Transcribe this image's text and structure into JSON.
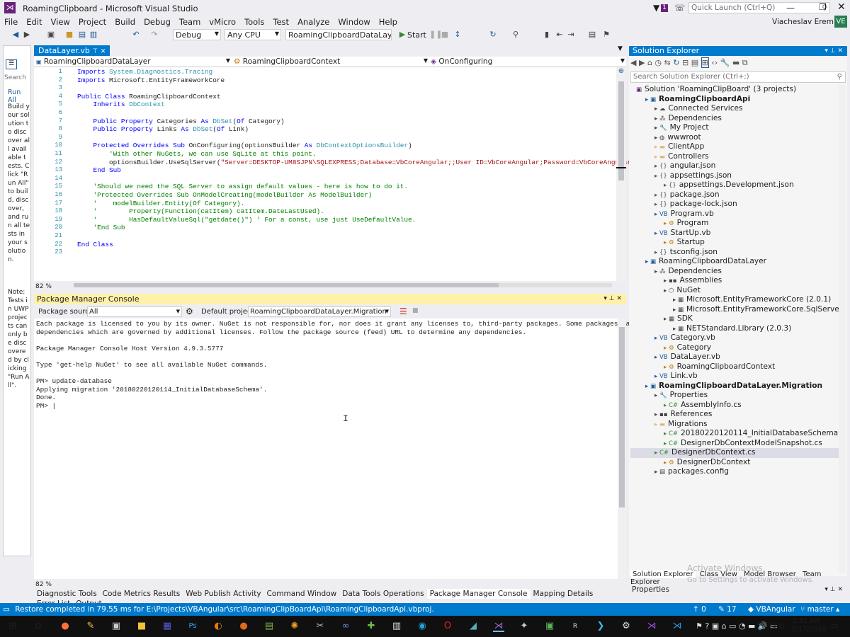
{
  "title": {
    "app": "RoamingClipboard - Microsoft Visual Studio",
    "quick_launch": "Quick Launch (Ctrl+Q)",
    "user": "Viacheslav Eremin",
    "avatar": "VE",
    "notif_count": "1"
  },
  "menu": [
    "File",
    "Edit",
    "View",
    "Project",
    "Build",
    "Debug",
    "Team",
    "vMicro",
    "Tools",
    "Test",
    "Analyze",
    "Window",
    "Help"
  ],
  "toolbar": {
    "config": "Debug",
    "platform": "Any CPU",
    "project": "RoamingClipboardDataLayer.Migra",
    "start": "Start"
  },
  "left_panel": {
    "run_all": "Run All",
    "search": "Search",
    "text1": "Build your solution to discover all available tests. Click \"Run All\" to build, discover, and run all tests in your solution.",
    "text2": "Note: Tests in UWP projects can only be discovered by clicking \"Run All\"."
  },
  "editor": {
    "tab": "DataLayer.vb",
    "nav_project": "RoamingClipboardDataLayer",
    "nav_class": "RoamingClipboardContext",
    "nav_member": "OnConfiguring",
    "zoom": "82 %",
    "lines": [
      {
        "n": "1",
        "t": "Imports System.Diagnostics.Tracing"
      },
      {
        "n": "2",
        "t": "Imports Microsoft.EntityFrameworkCore"
      },
      {
        "n": "3",
        "t": ""
      },
      {
        "n": "4",
        "t": "Public Class RoamingClipboardContext"
      },
      {
        "n": "5",
        "t": "    Inherits DbContext"
      },
      {
        "n": "6",
        "t": ""
      },
      {
        "n": "7",
        "t": "    Public Property Categories As DbSet(Of Category)"
      },
      {
        "n": "8",
        "t": "    Public Property Links As DbSet(Of Link)"
      },
      {
        "n": "9",
        "t": ""
      },
      {
        "n": "10",
        "t": "    Protected Overrides Sub OnConfiguring(optionsBuilder As DbContextOptionsBuilder)"
      },
      {
        "n": "11",
        "t": "        'With other NuGets, we can use SqLite at this point."
      },
      {
        "n": "12",
        "t": "        optionsBuilder.UseSqlServer(\"Server=DESKTOP-UM8SJPN\\SQLEXPRESS;Database=VbCoreAngular;;User ID=VbCoreAngular;Password=VbCoreAngular;;\")"
      },
      {
        "n": "13",
        "t": "    End Sub"
      },
      {
        "n": "14",
        "t": ""
      },
      {
        "n": "15",
        "t": "    'Should we need the SQL Server to assign default values - here is how to do it."
      },
      {
        "n": "16",
        "t": "    'Protected Overrides Sub OnModelCreating(modelBuilder As ModelBuilder)"
      },
      {
        "n": "17",
        "t": "    '    modelBuilder.Entity(Of Category)."
      },
      {
        "n": "18",
        "t": "    '        Property(Function(catItem) catItem.DateLastUsed)."
      },
      {
        "n": "19",
        "t": "    '        HasDefaultValueSql(\"getdate()\") ' For a const, use just UseDefaultValue."
      },
      {
        "n": "20",
        "t": "    'End Sub"
      },
      {
        "n": "21",
        "t": ""
      },
      {
        "n": "22",
        "t": "End Class"
      },
      {
        "n": "23",
        "t": ""
      }
    ]
  },
  "pmc": {
    "title": "Package Manager Console",
    "source_label": "Package source:",
    "source": "All",
    "default_label": "Default project:",
    "default_project": "RoamingClipboardDataLayer.Migration",
    "zoom": "82 %",
    "lines": [
      "Each package is licensed to you by its owner. NuGet is not responsible for, nor does it grant any licenses to, third-party packages. Some packages may include",
      "dependencies which are governed by additional licenses. Follow the package source (feed) URL to determine any dependencies.",
      "",
      "Package Manager Console Host Version 4.9.3.5777",
      "",
      "Type 'get-help NuGet' to see all available NuGet commands.",
      "",
      "PM> update-database",
      "Applying migration '20180220120114_InitialDatabaseSchema'.",
      "Done.",
      "PM> |"
    ]
  },
  "bottom_tabs": [
    "Diagnostic Tools",
    "Code Metrics Results",
    "Web Publish Activity",
    "Command Window",
    "Data Tools Operations",
    "Package Manager Console",
    "Mapping Details",
    "Error List",
    "Output"
  ],
  "solution": {
    "title": "Solution Explorer",
    "search": "Search Solution Explorer (Ctrl+;)",
    "items": [
      {
        "d": 0,
        "t": "Solution 'RoamingClipBoard' (3 projects)",
        "i": "sln"
      },
      {
        "d": 1,
        "t": "RoamingClipboardApi",
        "i": "proj",
        "b": true
      },
      {
        "d": 2,
        "t": "Connected Services",
        "i": "cs"
      },
      {
        "d": 2,
        "t": "Dependencies",
        "i": "dep"
      },
      {
        "d": 2,
        "t": "My Project",
        "i": "wrench"
      },
      {
        "d": 2,
        "t": "wwwroot",
        "i": "globe"
      },
      {
        "d": 2,
        "t": "ClientApp",
        "i": "folder"
      },
      {
        "d": 2,
        "t": "Controllers",
        "i": "folder"
      },
      {
        "d": 2,
        "t": "angular.json",
        "i": "json"
      },
      {
        "d": 2,
        "t": "appsettings.json",
        "i": "json"
      },
      {
        "d": 3,
        "t": "appsettings.Development.json",
        "i": "json"
      },
      {
        "d": 2,
        "t": "package.json",
        "i": "json"
      },
      {
        "d": 2,
        "t": "package-lock.json",
        "i": "json"
      },
      {
        "d": 2,
        "t": "Program.vb",
        "i": "vb"
      },
      {
        "d": 3,
        "t": "Program",
        "i": "cls"
      },
      {
        "d": 2,
        "t": "StartUp.vb",
        "i": "vb"
      },
      {
        "d": 3,
        "t": "Startup",
        "i": "cls"
      },
      {
        "d": 2,
        "t": "tsconfig.json",
        "i": "json"
      },
      {
        "d": 1,
        "t": "RoamingClipboardDataLayer",
        "i": "proj"
      },
      {
        "d": 2,
        "t": "Dependencies",
        "i": "dep"
      },
      {
        "d": 3,
        "t": "Assemblies",
        "i": "asm"
      },
      {
        "d": 3,
        "t": "NuGet",
        "i": "nuget"
      },
      {
        "d": 4,
        "t": "Microsoft.EntityFrameworkCore (2.0.1)",
        "i": "pkg"
      },
      {
        "d": 4,
        "t": "Microsoft.EntityFrameworkCore.SqlServer (2.0.1)",
        "i": "pkg"
      },
      {
        "d": 3,
        "t": "SDK",
        "i": "sdk"
      },
      {
        "d": 4,
        "t": "NETStandard.Library (2.0.3)",
        "i": "pkg"
      },
      {
        "d": 2,
        "t": "Category.vb",
        "i": "vb"
      },
      {
        "d": 3,
        "t": "Category",
        "i": "cls"
      },
      {
        "d": 2,
        "t": "DataLayer.vb",
        "i": "vb"
      },
      {
        "d": 3,
        "t": "RoamingClipboardContext",
        "i": "cls"
      },
      {
        "d": 2,
        "t": "Link.vb",
        "i": "vb"
      },
      {
        "d": 1,
        "t": "RoamingClipboardDataLayer.Migration",
        "i": "proj",
        "b": true
      },
      {
        "d": 2,
        "t": "Properties",
        "i": "wrench"
      },
      {
        "d": 3,
        "t": "AssemblyInfo.cs",
        "i": "csf"
      },
      {
        "d": 2,
        "t": "References",
        "i": "asm"
      },
      {
        "d": 2,
        "t": "Migrations",
        "i": "folder"
      },
      {
        "d": 3,
        "t": "20180220120114_InitialDatabaseSchema.cs",
        "i": "csf"
      },
      {
        "d": 3,
        "t": "DesignerDbContextModelSnapshot.cs",
        "i": "csf"
      },
      {
        "d": 2,
        "t": "DesignerDbContext.cs",
        "i": "csf",
        "sel": true
      },
      {
        "d": 3,
        "t": "DesignerDbContext",
        "i": "cls"
      },
      {
        "d": 2,
        "t": "packages.config",
        "i": "cfg"
      }
    ],
    "tabs": [
      "Solution Explorer",
      "Class View",
      "Model Browser",
      "Team Explorer"
    ],
    "properties": "Properties",
    "watermark1": "Activate Windows",
    "watermark2": "Go to Settings to activate Windows."
  },
  "status": {
    "message": "Restore completed in 79.55 ms for E:\\Projects\\VBAngular\\src\\RoamingClipBoardApi\\RoamingClipboardApi.vbproj.",
    "up": "0",
    "edits": "17",
    "repo": "VBAngular",
    "branch": "master"
  },
  "taskbar": {
    "time": "2:31 AM",
    "date": "2/17/2020",
    "lang": "ENG"
  },
  "colors": {
    "accent": "#007acc",
    "pmc_header": "#fff1a9"
  }
}
